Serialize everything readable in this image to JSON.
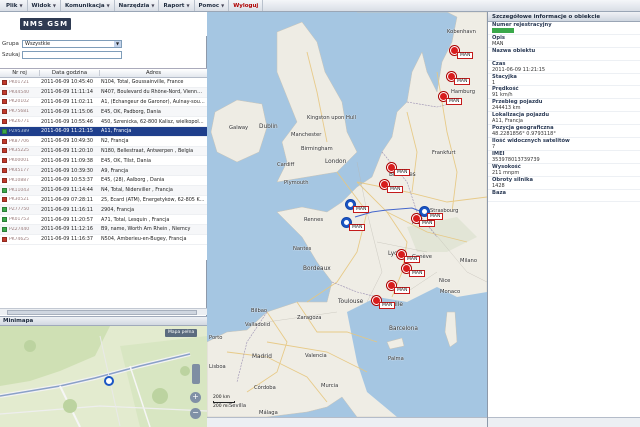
{
  "menu": [
    {
      "label": "Plik"
    },
    {
      "label": "Widok"
    },
    {
      "label": "Komunikacja"
    },
    {
      "label": "Narzędzia"
    },
    {
      "label": "Raport"
    },
    {
      "label": "Pomoc"
    },
    {
      "label": "Wyloguj"
    }
  ],
  "logo": "NMS GSM",
  "filter": {
    "group_label": "Grupa",
    "group_value": "Wszystkie",
    "search_label": "Szukaj",
    "search_value": ""
  },
  "table": {
    "headers": [
      "Nr rej",
      "Data godzina",
      "Adres"
    ],
    "rows": [
      {
        "status": "#c0392b",
        "reg": "PK01721",
        "datetime": "2011-06-09 10:45:40",
        "address": "N104, Total, Goussainville, France"
      },
      {
        "status": "#c0392b",
        "reg": "PK44540",
        "datetime": "2011-06-09 11:11:14",
        "address": "N407, Boulevard du Rhône-Nord, Vienne , Francja"
      },
      {
        "status": "#c0392b",
        "reg": "PK20102",
        "datetime": "2011-06-09 11:02:11",
        "address": "A1, (Échangeur de Garonor), Aulnay-sous-Bois, Francja"
      },
      {
        "status": "#c0392b",
        "reg": "PK75681",
        "datetime": "2011-06-09 11:15:06",
        "address": "E45, OK, Padborg, Dania"
      },
      {
        "status": "#c0392b",
        "reg": "PKZ6771",
        "datetime": "2011-06-09 10:55:46",
        "address": "450, Szrenicka, 62-800 Kalisz, wielkopolskie, Polska"
      },
      {
        "status": "#3aa84a",
        "reg": "PZ95389",
        "datetime": "2011-06-09 11:21:15",
        "address": "A11, Francja",
        "selected": true
      },
      {
        "status": "#c0392b",
        "reg": "PK87706",
        "datetime": "2011-06-09 10:49:30",
        "address": "N2, Francja"
      },
      {
        "status": "#c0392b",
        "reg": "PK35225",
        "datetime": "2011-06-09 11:20:10",
        "address": "N180, Bellestraat, Antwerpen , Belgia"
      },
      {
        "status": "#c0392b",
        "reg": "PK00001",
        "datetime": "2011-06-09 11:09:38",
        "address": "E45, OK, Tilst, Dania"
      },
      {
        "status": "#c0392b",
        "reg": "PK45177",
        "datetime": "2011-06-09 10:39:30",
        "address": "A9, Francja"
      },
      {
        "status": "#c0392b",
        "reg": "PK10887",
        "datetime": "2011-06-09 10:53:37",
        "address": "E45, (28), Aalborg , Dania"
      },
      {
        "status": "#3aa84a",
        "reg": "PK11043",
        "datetime": "2011-06-09 11:14:44",
        "address": "N4, Total, Niderviller , Francja"
      },
      {
        "status": "#c0392b",
        "reg": "PK30521",
        "datetime": "2011-06-09 07:28:11",
        "address": "25, Ecard (ATM), Energetyków, 62-805 Kalisz, wielk"
      },
      {
        "status": "#3aa84a",
        "reg": "PZ77750",
        "datetime": "2011-06-09 11:16:11",
        "address": "2904, Francja"
      },
      {
        "status": "#3aa84a",
        "reg": "PK01753",
        "datetime": "2011-06-09 11:20:57",
        "address": "A71, Total, Lesquin , Francja"
      },
      {
        "status": "#3aa84a",
        "reg": "PZ27440",
        "datetime": "2011-06-09 11:12:16",
        "address": "B9, name, Worth Am Rhein , Niemcy"
      },
      {
        "status": "#c0392b",
        "reg": "PK74625",
        "datetime": "2011-06-09 11:16:37",
        "address": "N504, Amberieu-en-Bugey, Francja"
      }
    ]
  },
  "minimap": {
    "title": "Minimapa",
    "link_label": "Mapa pełna"
  },
  "map": {
    "marker_label": "MAN",
    "scale_top": "200 km",
    "scale_bottom": "200 mi",
    "cities": [
      {
        "name": "Galway"
      },
      {
        "name": "Dublin"
      },
      {
        "name": "Kingston upon Hull"
      },
      {
        "name": "Manchester"
      },
      {
        "name": "Birmingham"
      },
      {
        "name": "Cardiff"
      },
      {
        "name": "London"
      },
      {
        "name": "Plymouth"
      },
      {
        "name": "Rennes"
      },
      {
        "name": "Nantes"
      },
      {
        "name": "Bordeaux"
      },
      {
        "name": "Toulouse"
      },
      {
        "name": "Barcelona"
      },
      {
        "name": "Bilbao"
      },
      {
        "name": "Porto"
      },
      {
        "name": "Valladolid"
      },
      {
        "name": "Zaragoza"
      },
      {
        "name": "Madrid"
      },
      {
        "name": "Valencia"
      },
      {
        "name": "Lisboa"
      },
      {
        "name": "Córdoba"
      },
      {
        "name": "Murcia"
      },
      {
        "name": "Sevilla"
      },
      {
        "name": "Málaga"
      },
      {
        "name": "Bruxelles"
      },
      {
        "name": "Frankfurt"
      },
      {
        "name": "Strasbourg"
      },
      {
        "name": "Freiburg"
      },
      {
        "name": "Genève"
      },
      {
        "name": "Lyon"
      },
      {
        "name": "Milano"
      },
      {
        "name": "Marseille"
      },
      {
        "name": "Nice"
      },
      {
        "name": "Monaco"
      },
      {
        "name": "Kobenhavn"
      },
      {
        "name": "Hamburg"
      },
      {
        "name": "Palma"
      }
    ]
  },
  "details": {
    "title": "Szczegółowe informacje o obiekcie",
    "fields": [
      {
        "label": "Numer rejestracyjny",
        "value": "",
        "badge": true
      },
      {
        "label": "Opis",
        "value": "MAN"
      },
      {
        "label": "Nazwa obiektu",
        "value": ""
      },
      {
        "label": "Czas",
        "value": "2011-06-09 11:21:15"
      },
      {
        "label": "Stacyjka",
        "value": "1"
      },
      {
        "label": "Prędkość",
        "value": "91 km/h"
      },
      {
        "label": "Przebieg pojazdu",
        "value": "244413 km"
      },
      {
        "label": "Lokalizacja pojazdu",
        "value": "A11, Francja"
      },
      {
        "label": "Pozycja geograficzna",
        "value": "48.2281856° 0.9793118°"
      },
      {
        "label": "Ilość widocznych satelitów",
        "value": "7"
      },
      {
        "label": "IMEI",
        "value": "353978013739739"
      },
      {
        "label": "Wysokość",
        "value": "211 mnpm"
      },
      {
        "label": "Obroty silnika",
        "value": "1428"
      },
      {
        "label": "Baza",
        "value": ""
      }
    ]
  }
}
